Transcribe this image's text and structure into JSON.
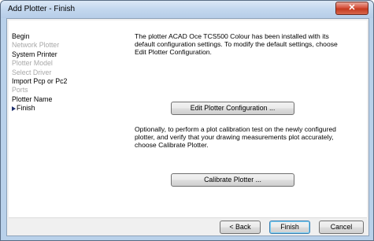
{
  "window": {
    "title": "Add Plotter - Finish",
    "close_glyph": "✕"
  },
  "steps": [
    {
      "label": "Begin",
      "state": "normal"
    },
    {
      "label": "Network Plotter",
      "state": "disabled"
    },
    {
      "label": "System Printer",
      "state": "normal"
    },
    {
      "label": "Plotter Model",
      "state": "disabled"
    },
    {
      "label": "Select Driver",
      "state": "disabled"
    },
    {
      "label": "Import Pcp or Pc2",
      "state": "normal"
    },
    {
      "label": "Ports",
      "state": "disabled"
    },
    {
      "label": "Plotter Name",
      "state": "normal"
    },
    {
      "label": "Finish",
      "state": "current"
    }
  ],
  "content": {
    "installed_text": "The plotter ACAD Oce TCS500 Colour has been installed with its default configuration settings.  To modify the default settings, choose Edit Plotter Configuration.",
    "edit_button": "Edit Plotter Configuration ...",
    "calibrate_text": "Optionally, to perform a plot calibration test on the newly configured plotter, and verify that your drawing measurements plot accurately, choose Calibrate Plotter.",
    "calibrate_button": "Calibrate Plotter ..."
  },
  "footer": {
    "back": "< Back",
    "finish": "Finish",
    "cancel": "Cancel"
  },
  "colors": {
    "current_step_arrow": "#1f2f6e",
    "disabled_text": "#a8a8a8",
    "close_button": "#c43a1f"
  }
}
